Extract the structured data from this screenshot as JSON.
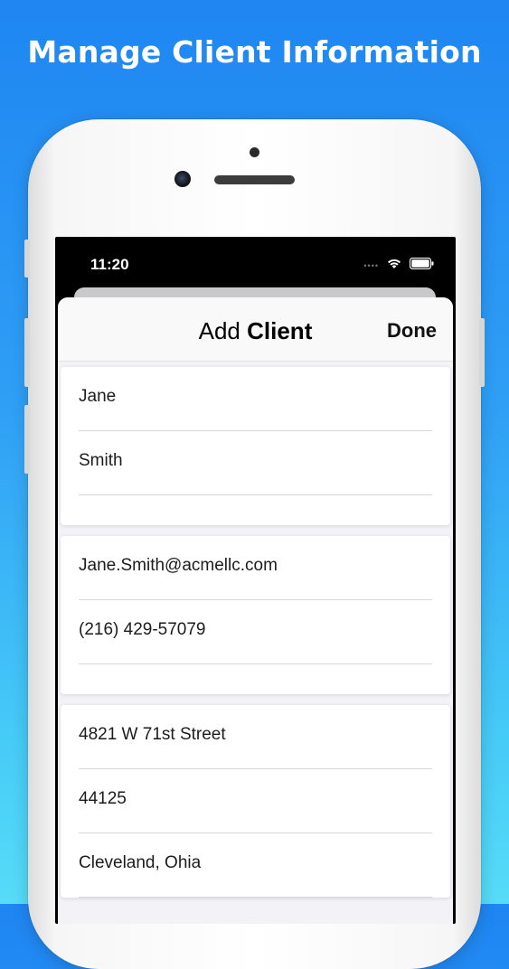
{
  "headline": "Manage Client Information",
  "status_bar": {
    "time": "11:20",
    "signal": "••••"
  },
  "nav": {
    "title_light": "Add",
    "title_bold": "Client",
    "done_label": "Done"
  },
  "sections": [
    {
      "fields": [
        "Jane",
        "Smith"
      ]
    },
    {
      "fields": [
        "Jane.Smith@acmellc.com",
        "(216) 429-57079"
      ]
    },
    {
      "fields": [
        "4821 W 71st Street",
        "44125",
        "Cleveland, Ohia"
      ]
    }
  ],
  "colors": {
    "background_top": "#1f86f2",
    "background_bottom": "#56dcf8",
    "sheet": "#f2f2f7"
  },
  "icons": [
    "wifi-icon",
    "battery-icon",
    "cellular-signal-icon"
  ]
}
